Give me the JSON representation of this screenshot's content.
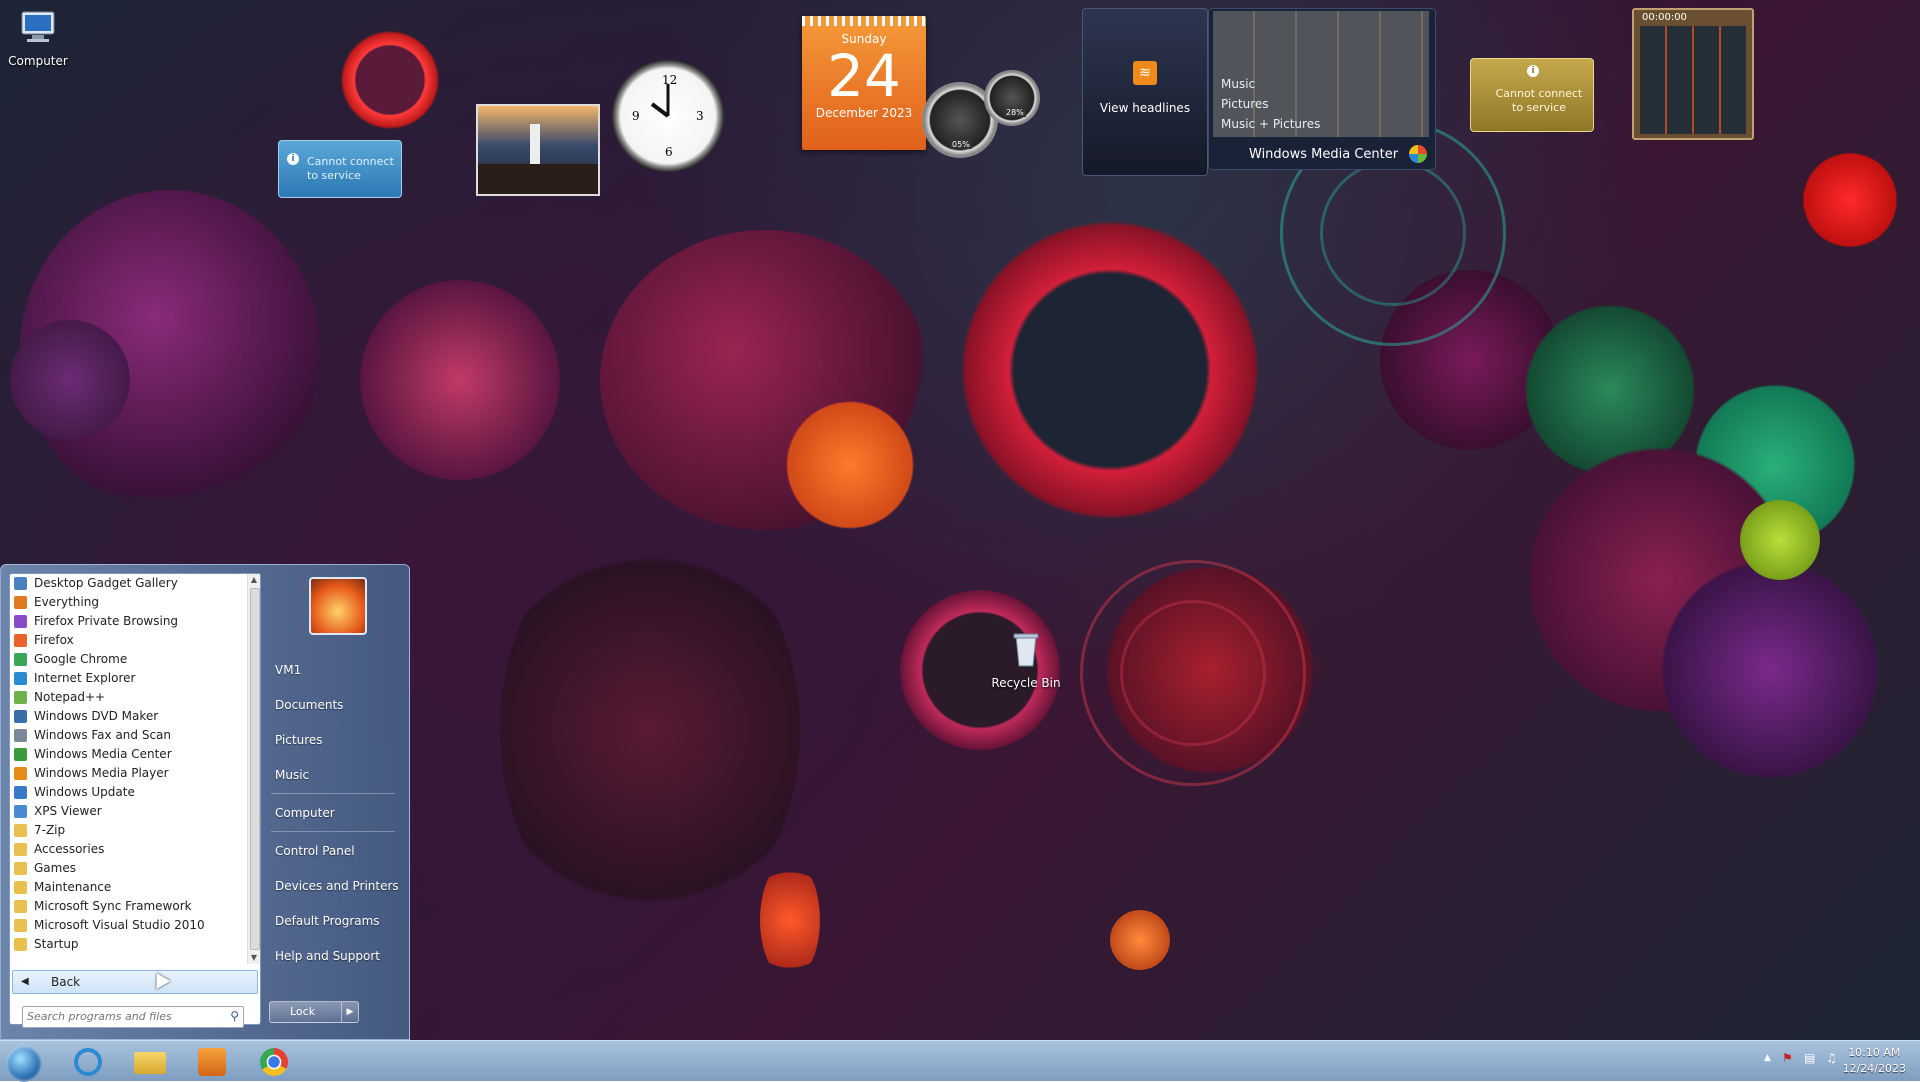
{
  "desktop": {
    "icons": [
      {
        "label": "Computer"
      },
      {
        "label": "Recycle Bin"
      }
    ],
    "gadgets": {
      "notice_left": "Cannot connect to service",
      "notice_right": "Cannot connect to service",
      "calendar": {
        "weekday": "Sunday",
        "day": "24",
        "month_year": "December 2023"
      },
      "cpu_meter": {
        "cpu": "05%",
        "ram": "28%"
      },
      "feed": {
        "label": "View headlines"
      },
      "media_center": {
        "items": [
          "Music",
          "Pictures",
          "Music + Pictures"
        ],
        "title": "Windows Media Center"
      },
      "puzzle": {
        "timer": "00:00:00"
      },
      "clock_icon": "analog-clock-icon",
      "slideshow_icon": "lighthouse-photo"
    }
  },
  "start_menu": {
    "programs": [
      {
        "label": "Desktop Gadget Gallery",
        "icon": "gadget-icon",
        "color": "#4a7fc0"
      },
      {
        "label": "Everything",
        "icon": "search-icon",
        "color": "#e07a20"
      },
      {
        "label": "Firefox Private Browsing",
        "icon": "firefox-private-icon",
        "color": "#8a4cc8"
      },
      {
        "label": "Firefox",
        "icon": "firefox-icon",
        "color": "#e8622a"
      },
      {
        "label": "Google Chrome",
        "icon": "chrome-icon",
        "color": "#3aa757"
      },
      {
        "label": "Internet Explorer",
        "icon": "ie-icon",
        "color": "#2a8ad4"
      },
      {
        "label": "Notepad++",
        "icon": "notepad-icon",
        "color": "#6fb04a"
      },
      {
        "label": "Windows DVD Maker",
        "icon": "dvd-icon",
        "color": "#3a6ea8"
      },
      {
        "label": "Windows Fax and Scan",
        "icon": "fax-icon",
        "color": "#7a8a9a"
      },
      {
        "label": "Windows Media Center",
        "icon": "media-center-icon",
        "color": "#3a9a3a"
      },
      {
        "label": "Windows Media Player",
        "icon": "media-player-icon",
        "color": "#e88a1a"
      },
      {
        "label": "Windows Update",
        "icon": "update-icon",
        "color": "#3a78c8"
      },
      {
        "label": "XPS Viewer",
        "icon": "xps-icon",
        "color": "#4a8ad0"
      },
      {
        "label": "7-Zip",
        "icon": "folder-icon",
        "color": "#e8c050"
      },
      {
        "label": "Accessories",
        "icon": "folder-icon",
        "color": "#e8c050"
      },
      {
        "label": "Games",
        "icon": "folder-icon",
        "color": "#e8c050"
      },
      {
        "label": "Maintenance",
        "icon": "folder-icon",
        "color": "#e8c050"
      },
      {
        "label": "Microsoft Sync Framework",
        "icon": "folder-icon",
        "color": "#e8c050"
      },
      {
        "label": "Microsoft Visual Studio 2010",
        "icon": "folder-icon",
        "color": "#e8c050"
      },
      {
        "label": "Startup",
        "icon": "folder-icon",
        "color": "#e8c050"
      }
    ],
    "back_label": "Back",
    "search_placeholder": "Search programs and files",
    "right_links": {
      "user": "VM1",
      "documents": "Documents",
      "pictures": "Pictures",
      "music": "Music",
      "computer": "Computer",
      "control_panel": "Control Panel",
      "devices": "Devices and Printers",
      "default_programs": "Default Programs",
      "help": "Help and Support"
    },
    "lock_label": "Lock"
  },
  "taskbar": {
    "pinned": [
      "internet-explorer-icon",
      "file-explorer-icon",
      "media-player-icon",
      "chrome-icon"
    ],
    "clock": {
      "time": "10:10 AM",
      "date": "12/24/2023"
    }
  }
}
